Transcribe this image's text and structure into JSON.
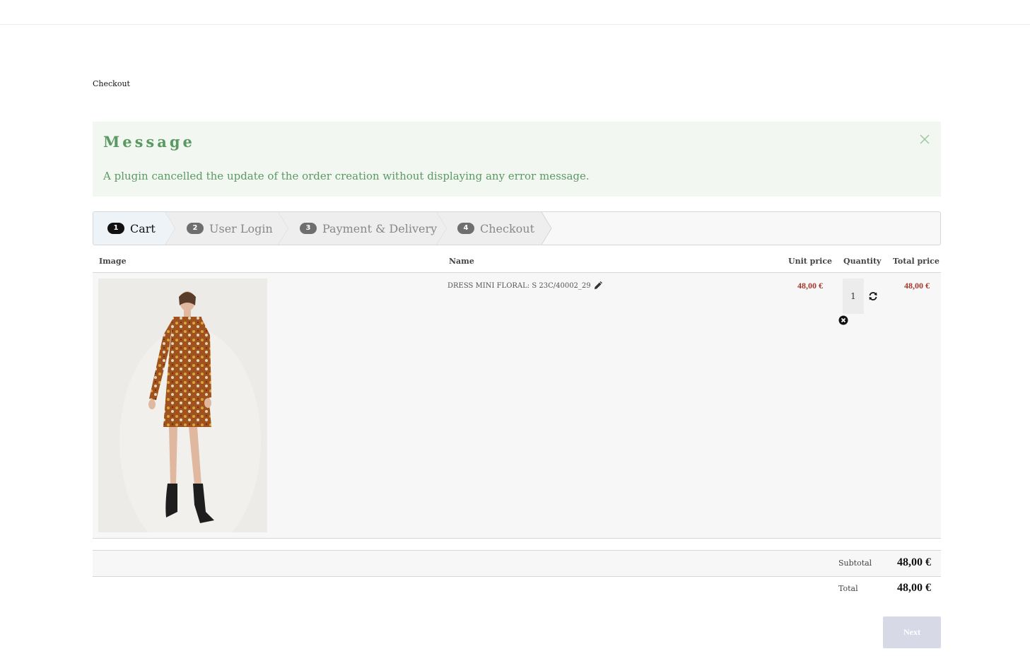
{
  "breadcrumb": {
    "current": "Checkout"
  },
  "message": {
    "title": "Message",
    "text": "A plugin cancelled the update of the order creation without displaying any error message."
  },
  "steps": [
    {
      "num": "1",
      "label": "Cart",
      "active": true
    },
    {
      "num": "2",
      "label": "User Login",
      "active": false
    },
    {
      "num": "3",
      "label": "Payment & Delivery",
      "active": false
    },
    {
      "num": "4",
      "label": "Checkout",
      "active": false
    }
  ],
  "cart": {
    "columns": {
      "image": "Image",
      "name": "Name",
      "unit_price": "Unit price",
      "quantity": "Quantity",
      "total_price": "Total price"
    },
    "items": [
      {
        "name": "DRESS MINI FLORAL: S 23C/40002_29",
        "unit_price": "48,00 €",
        "quantity": "1",
        "total_price": "48,00 €"
      }
    ]
  },
  "summary": {
    "subtotal_label": "Subtotal",
    "subtotal_value": "48,00 €",
    "total_label": "Total",
    "total_value": "48,00 €"
  },
  "actions": {
    "next_label": "Next"
  },
  "colors": {
    "message_bg": "#f2f7f1",
    "message_text": "#5a9a62",
    "price": "#a23a2e",
    "next_button_bg": "#d8d9e6"
  },
  "icons": {
    "close": "close-icon",
    "edit": "pencil-icon",
    "refresh": "refresh-icon",
    "remove": "remove-circle-icon"
  }
}
